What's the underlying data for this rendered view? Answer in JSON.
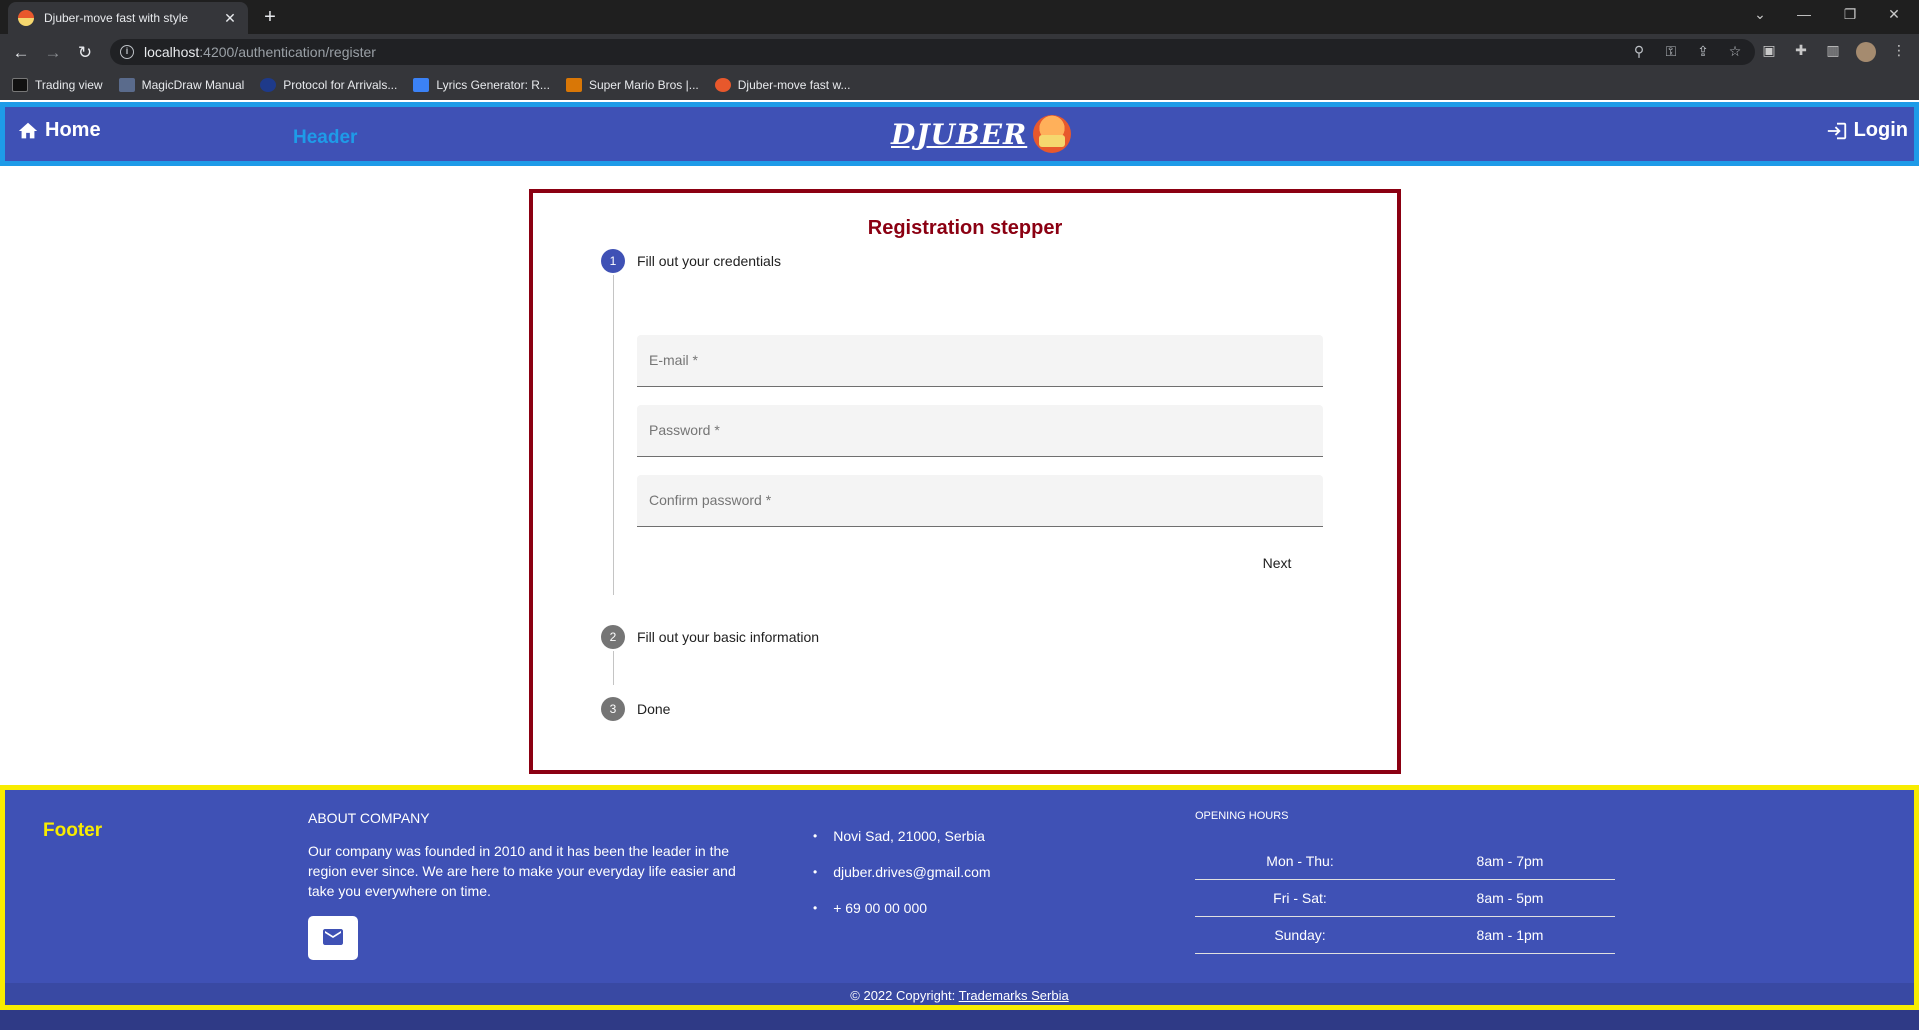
{
  "browser": {
    "tab_title": "Djuber-move fast with style",
    "url_host": "localhost",
    "url_path": ":4200/authentication/register",
    "bookmarks": [
      {
        "label": "Trading view",
        "color": "#111111"
      },
      {
        "label": "MagicDraw Manual",
        "color": "#5a6b8c"
      },
      {
        "label": "Protocol for Arrivals...",
        "color": "#1e3a8a"
      },
      {
        "label": "Lyrics Generator: R...",
        "color": "#3b82f6"
      },
      {
        "label": "Super Mario Bros |...",
        "color": "#d97706"
      },
      {
        "label": "Djuber-move fast w...",
        "color": "#e8582c"
      }
    ]
  },
  "header": {
    "home_label": "Home",
    "tag_label": "Header",
    "brand": "DJUBER",
    "login_label": "Login",
    "bg_color": "#3f51b5",
    "border_color": "#1e9be8"
  },
  "stepper": {
    "title": "Registration stepper",
    "border_color": "#8b0012",
    "steps": [
      {
        "number": "1",
        "label": "Fill out your credentials",
        "state": "active"
      },
      {
        "number": "2",
        "label": "Fill out your basic information",
        "state": "pending"
      },
      {
        "number": "3",
        "label": "Done",
        "state": "pending"
      }
    ],
    "fields": [
      {
        "label": "E-mail *",
        "value": ""
      },
      {
        "label": "Password *",
        "value": ""
      },
      {
        "label": "Confirm password *",
        "value": ""
      }
    ],
    "next_label": "Next"
  },
  "footer": {
    "tag_label": "Footer",
    "about_title": "ABOUT COMPANY",
    "about_text": "Our company was founded in 2010 and it has been the leader in the region ever since. We are here to make your everyday life easier and take you everywhere on time.",
    "contacts": [
      "Novi Sad, 21000, Serbia",
      "djuber.drives@gmail.com",
      "+ 69 00 00 000"
    ],
    "hours_title": "OPENING HOURS",
    "hours": [
      {
        "day": "Mon - Thu:",
        "time": "8am - 7pm"
      },
      {
        "day": "Fri - Sat:",
        "time": "8am - 5pm"
      },
      {
        "day": "Sunday:",
        "time": "8am - 1pm"
      }
    ],
    "copyright_prefix": "© 2022 Copyright: ",
    "copyright_link": "Trademarks Serbia",
    "border_color": "#f8ec00"
  }
}
